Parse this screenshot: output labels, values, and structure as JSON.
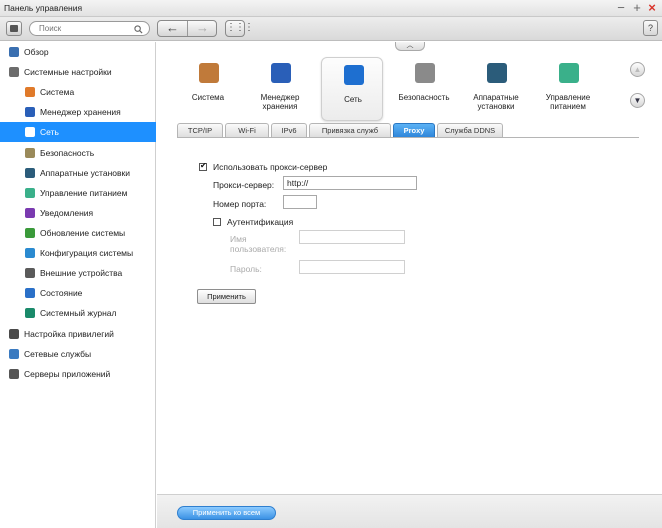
{
  "window": {
    "title": "Панель управления",
    "min_glyph": "−",
    "max_glyph": "+",
    "close_glyph": "×"
  },
  "toolbar": {
    "search_placeholder": "Поиск",
    "search_icon": "search-icon",
    "back_glyph": "←",
    "forward_glyph": "→",
    "grid_glyph": "⋮⋮⋮",
    "help_label": "?"
  },
  "sidebar": {
    "items": [
      {
        "label": "Обзор",
        "level": "top",
        "icon": "overview-icon",
        "color": "#3a6fb0"
      },
      {
        "label": "Системные настройки",
        "level": "top",
        "icon": "gear-icon",
        "color": "#6c6c6c"
      },
      {
        "label": "Система",
        "level": "sub",
        "icon": "system-icon",
        "color": "#e07a2a"
      },
      {
        "label": "Менеджер хранения",
        "level": "sub",
        "icon": "storage-icon",
        "color": "#2a5fb8"
      },
      {
        "label": "Сеть",
        "level": "sub",
        "icon": "network-icon",
        "color": "#ffffff",
        "active": true
      },
      {
        "label": "Безопасность",
        "level": "sub",
        "icon": "lock-icon",
        "color": "#9a8a5a"
      },
      {
        "label": "Аппаратные установки",
        "level": "sub",
        "icon": "hardware-icon",
        "color": "#2b5c7a"
      },
      {
        "label": "Управление питанием",
        "level": "sub",
        "icon": "power-icon",
        "color": "#3ab08a"
      },
      {
        "label": "Уведомления",
        "level": "sub",
        "icon": "notification-icon",
        "color": "#7a3ab0"
      },
      {
        "label": "Обновление системы",
        "level": "sub",
        "icon": "update-icon",
        "color": "#3a9a3a"
      },
      {
        "label": "Конфигурация системы",
        "level": "sub",
        "icon": "config-icon",
        "color": "#2a8ad0"
      },
      {
        "label": "Внешние устройства",
        "level": "sub",
        "icon": "device-icon",
        "color": "#5a5a5a"
      },
      {
        "label": "Состояние",
        "level": "sub",
        "icon": "monitor-icon",
        "color": "#2a70c8"
      },
      {
        "label": "Системный журнал",
        "level": "sub",
        "icon": "log-icon",
        "color": "#1a8a6a"
      },
      {
        "label": "Настройка привилегий",
        "level": "top",
        "icon": "user-icon",
        "color": "#4a4a4a"
      },
      {
        "label": "Сетевые службы",
        "level": "top",
        "icon": "network-services-icon",
        "color": "#3a7ac0"
      },
      {
        "label": "Серверы приложений",
        "level": "top",
        "icon": "app-server-icon",
        "color": "#555555"
      }
    ]
  },
  "categories": [
    {
      "label": "Система",
      "icon": "system-icon",
      "color": "#c07a3a"
    },
    {
      "label": "Менеджер хранения",
      "icon": "storage-icon",
      "color": "#2a5fb8"
    },
    {
      "label": "Сеть",
      "icon": "network-icon",
      "color": "#1e6fd0",
      "active": true
    },
    {
      "label": "Безопасность",
      "icon": "lock-icon",
      "color": "#8a8a8a"
    },
    {
      "label": "Аппаратные установки",
      "icon": "hardware-icon",
      "color": "#2b5c7a"
    },
    {
      "label": "Управление питанием",
      "icon": "power-icon",
      "color": "#3ab08a"
    }
  ],
  "tabs": [
    {
      "label": "TCP/IP"
    },
    {
      "label": "Wi-Fi"
    },
    {
      "label": "IPv6"
    },
    {
      "label": "Привязка служб"
    },
    {
      "label": "Proxy",
      "active": true
    },
    {
      "label": "Служба DDNS"
    }
  ],
  "proxy_form": {
    "use_proxy_label": "Использовать прокси-сервер",
    "use_proxy_checked": true,
    "proxy_server_label": "Прокси-сервер:",
    "proxy_server_value": "http://",
    "port_label": "Номер порта:",
    "port_value": "",
    "auth_label": "Аутентификация",
    "auth_checked": false,
    "username_label_1": "Имя",
    "username_label_2": "пользователя:",
    "username_value": "",
    "password_label": "Пароль:",
    "password_value": "",
    "apply_label": "Применить"
  },
  "footer": {
    "apply_all_label": "Применить ко всем"
  }
}
